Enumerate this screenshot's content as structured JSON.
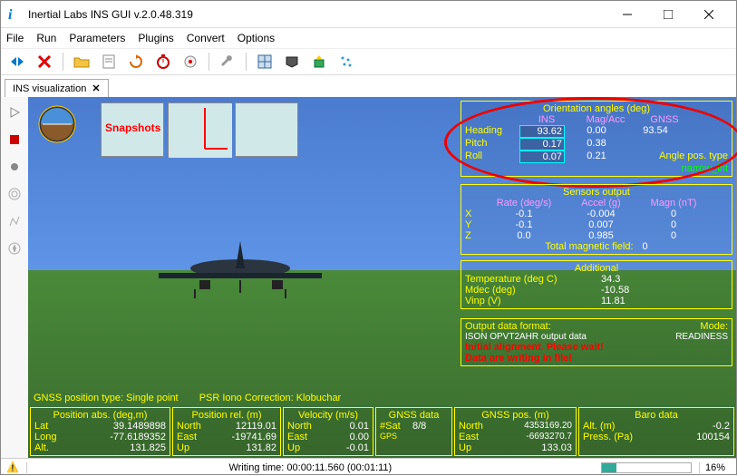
{
  "window": {
    "title": "Inertial Labs INS GUI v.2.0.48.319"
  },
  "menu": {
    "file": "File",
    "run": "Run",
    "parameters": "Parameters",
    "plugins": "Plugins",
    "convert": "Convert",
    "options": "Options"
  },
  "tab": {
    "label": "INS visualization"
  },
  "snapshots_label": "Snapshots",
  "orientation": {
    "title": "Orientation angles (deg)",
    "cols": {
      "ins": "INS",
      "magacc": "Mag/Acc",
      "gnss": "GNSS"
    },
    "heading": {
      "label": "Heading",
      "ins": "93.62",
      "magacc": "0.00",
      "gnss": "93.54"
    },
    "pitch": {
      "label": "Pitch",
      "ins": "0.17",
      "magacc": "0.38",
      "gnss": ""
    },
    "roll": {
      "label": "Roll",
      "ins": "0.07",
      "magacc": "0.21",
      "gnss": ""
    },
    "angle_pos_type_label": "Angle pos. type",
    "angle_pos_type": "narrow_int"
  },
  "sensors": {
    "title": "Sensors output",
    "cols": {
      "rate": "Rate (deg/s)",
      "accel": "Accel (g)",
      "magn": "Magn (nT)"
    },
    "x": {
      "label": "X",
      "rate": "-0.1",
      "accel": "-0.004",
      "magn": "0"
    },
    "y": {
      "label": "Y",
      "rate": "-0.1",
      "accel": "0.007",
      "magn": "0"
    },
    "z": {
      "label": "Z",
      "rate": "0.0",
      "accel": "0.985",
      "magn": "0"
    },
    "total_label": "Total magnetic field:",
    "total": "0"
  },
  "additional": {
    "title": "Additional",
    "temp_label": "Temperature (deg C)",
    "temp": "34.3",
    "mdec_label": "Mdec (deg)",
    "mdec": "-10.58",
    "vinp_label": "Vinp (V)",
    "vinp": "11.81"
  },
  "output": {
    "format_label": "Output data format:",
    "format": "ISON OPVT2AHR output data",
    "mode_label": "Mode:",
    "mode": "READINESS",
    "msg1": "Initial alignment. Please wait!",
    "msg2": "Data are writing in file!"
  },
  "gnss_line": {
    "pos_type_label": "GNSS position type:",
    "pos_type": "Single point",
    "psr_label": "PSR Iono Correction:",
    "psr": "Klobuchar"
  },
  "pos_abs": {
    "title": "Position abs. (deg,m)",
    "lat_label": "Lat",
    "lat": "39.1489898",
    "long_label": "Long",
    "long": "-77.6189352",
    "alt_label": "Alt.",
    "alt": "131.825"
  },
  "pos_rel": {
    "title": "Position rel. (m)",
    "north_label": "North",
    "north": "12119.01",
    "east_label": "East",
    "east": "-19741.69",
    "up_label": "Up",
    "up": "131.82"
  },
  "velocity": {
    "title": "Velocity (m/s)",
    "north_label": "North",
    "north": "0.01",
    "east_label": "East",
    "east": "0.00",
    "up_label": "Up",
    "up": "-0.01"
  },
  "gnss_data": {
    "title": "GNSS data",
    "sat_label": "#Sat",
    "sat": "8/8",
    "gps_label": "GPS"
  },
  "gnss_pos": {
    "title": "GNSS pos. (m)",
    "north_label": "North",
    "north": "4353169.20",
    "east_label": "East",
    "east": "-6693270.7",
    "up_label": "Up",
    "up": "133.03"
  },
  "baro": {
    "title": "Baro data",
    "alt_label": "Alt. (m)",
    "alt": "-0.2",
    "press_label": "Press. (Pa)",
    "press": "100154"
  },
  "status": {
    "writing": "Writing time: 00:00:11.560 (00:01:11)",
    "percent": "16%",
    "progress_value": 16
  }
}
